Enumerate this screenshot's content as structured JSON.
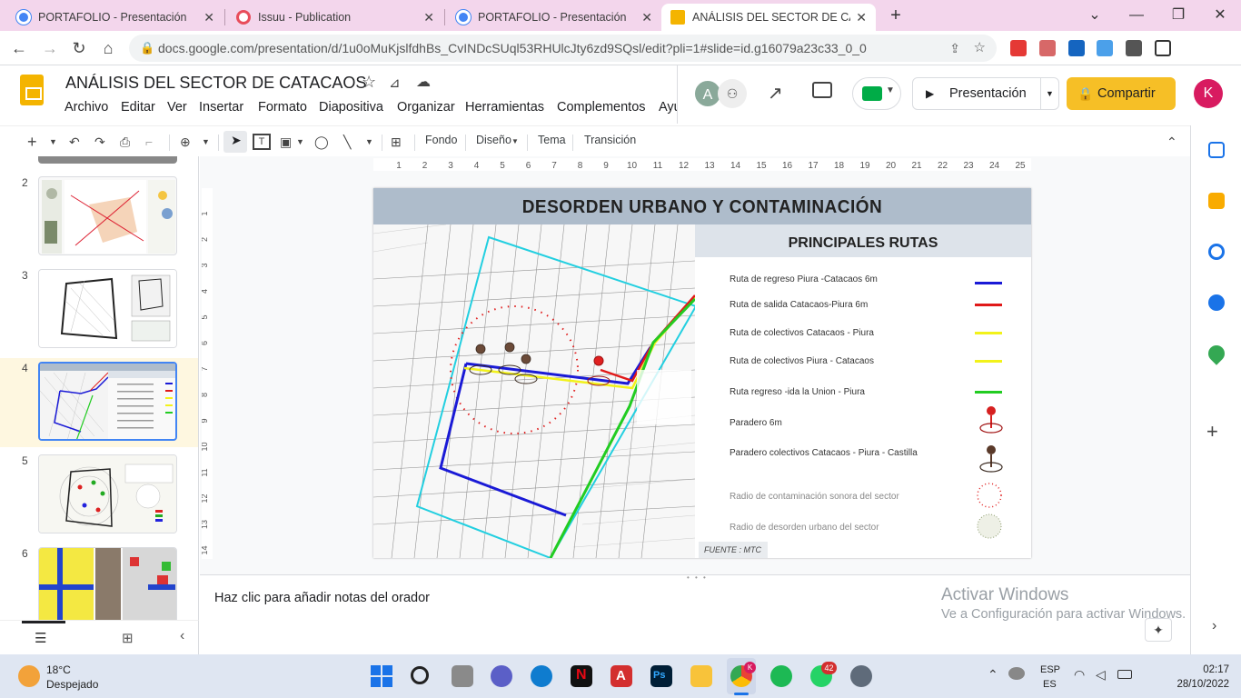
{
  "browser": {
    "tabs": [
      {
        "label": "PORTAFOLIO - Presentación",
        "icon": "chrome-icon",
        "active": false
      },
      {
        "label": "Issuu - Publication",
        "icon": "issuu-icon",
        "active": false
      },
      {
        "label": "PORTAFOLIO - Presentación",
        "icon": "chrome-icon",
        "active": false
      },
      {
        "label": "ANÁLISIS DEL SECTOR DE CATAC",
        "icon": "slides-icon",
        "active": true
      }
    ],
    "new_tab": "+",
    "url": "docs.google.com/presentation/d/1u0oMuKjslfdhBs_CvINDcSUql53RHUlcJty6zd9SQsl/edit?pli=1#slide=id.g16079a23c33_0_0"
  },
  "docs": {
    "title": "ANÁLISIS DEL SECTOR DE CATACAOS",
    "menu": [
      "Archivo",
      "Editar",
      "Ver",
      "Insertar",
      "Formato",
      "Diapositiva",
      "Organizar",
      "Herramientas",
      "Complementos",
      "Ayu"
    ],
    "present_label": "Presentación",
    "share_label": "Compartir",
    "avatar_letter": "K",
    "collab_avatar": "A"
  },
  "toolbar": {
    "fondo": "Fondo",
    "diseno": "Diseño",
    "tema": "Tema",
    "transicion": "Transición"
  },
  "ruler": {
    "top": [
      "1",
      "2",
      "3",
      "4",
      "5",
      "6",
      "7",
      "8",
      "9",
      "10",
      "11",
      "12",
      "13",
      "14",
      "15",
      "16",
      "17",
      "18",
      "19",
      "20",
      "21",
      "22",
      "23",
      "24",
      "25"
    ],
    "left": [
      "1",
      "2",
      "3",
      "4",
      "5",
      "6",
      "7",
      "8",
      "9",
      "10",
      "11",
      "12",
      "13",
      "14"
    ]
  },
  "filmstrip": {
    "slides": [
      "2",
      "3",
      "4",
      "5",
      "6"
    ],
    "active_slide": "4"
  },
  "slide": {
    "title": "DESORDEN URBANO Y CONTAMINACIÓN",
    "legend_title": "PRINCIPALES RUTAS",
    "legend": [
      {
        "label": "Ruta de regreso Piura -Catacaos 6m",
        "color": "#1a1ad6"
      },
      {
        "label": "Ruta de salida Catacaos-Piura 6m",
        "color": "#e01919"
      },
      {
        "label": "Ruta de colectivos Catacaos - Piura",
        "color": "#f2f21a"
      },
      {
        "label": "Ruta de colectivos Piura - Catacaos",
        "color": "#f2f21a"
      },
      {
        "label": "Ruta regreso -ida la Union - Piura",
        "color": "#22cc22"
      },
      {
        "label": "Paradero 6m",
        "color": "#d62020"
      },
      {
        "label": "Paradero colectivos Catacaos - Piura - Castilla",
        "color": "#5a3a2a"
      },
      {
        "label": "Radio de contaminación sonora del sector",
        "color": "#e02020"
      },
      {
        "label": "Radio de desorden urbano del sector",
        "color": "#8a9a6a"
      }
    ],
    "source": "FUENTE : MTC"
  },
  "notes": {
    "placeholder": "Haz clic para añadir notas del orador"
  },
  "watermark": {
    "line1": "Activar Windows",
    "line2": "Ve a Configuración para activar Windows."
  },
  "taskbar": {
    "temp": "18°C",
    "weather": "Despejado",
    "lang1": "ESP",
    "lang2": "ES",
    "time": "02:17",
    "date": "28/10/2022",
    "whatsapp_badge": "42",
    "chrome_badge": "K"
  }
}
